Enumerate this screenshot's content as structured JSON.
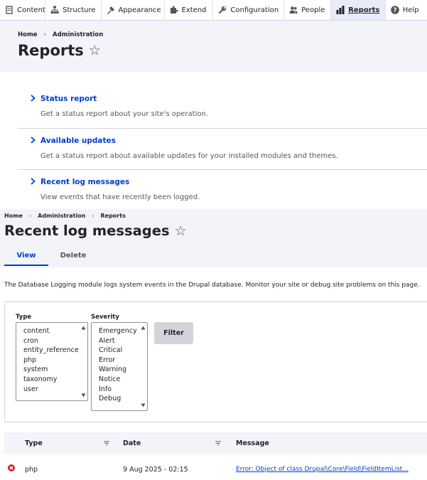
{
  "toolbar": {
    "items": [
      {
        "label": "Content",
        "icon": "content-icon"
      },
      {
        "label": "Structure",
        "icon": "structure-icon"
      },
      {
        "label": "Appearance",
        "icon": "appearance-icon"
      },
      {
        "label": "Extend",
        "icon": "extend-icon"
      },
      {
        "label": "Configuration",
        "icon": "configuration-icon"
      },
      {
        "label": "People",
        "icon": "people-icon"
      },
      {
        "label": "Reports",
        "icon": "reports-icon",
        "active": true
      },
      {
        "label": "Help",
        "icon": "help-icon"
      }
    ]
  },
  "reports_page": {
    "breadcrumb": [
      "Home",
      "Administration"
    ],
    "title": "Reports",
    "items": [
      {
        "title": "Status report",
        "description": "Get a status report about your site's operation."
      },
      {
        "title": "Available updates",
        "description": "Get a status report about available updates for your installed modules and themes."
      },
      {
        "title": "Recent log messages",
        "description": "View events that have recently been logged."
      }
    ]
  },
  "log_page": {
    "breadcrumb": [
      "Home",
      "Administration",
      "Reports"
    ],
    "title": "Recent log messages",
    "tabs": [
      {
        "label": "View",
        "active": true
      },
      {
        "label": "Delete",
        "active": false
      }
    ],
    "intro": "The Database Logging module logs system events in the Drupal database. Monitor your site or debug site problems on this page.",
    "filter": {
      "type_label": "Type",
      "type_options": [
        "content",
        "cron",
        "entity_reference",
        "php",
        "system",
        "taxonomy",
        "user"
      ],
      "severity_label": "Severity",
      "severity_options": [
        "Emergency",
        "Alert",
        "Critical",
        "Error",
        "Warning",
        "Notice",
        "Info",
        "Debug"
      ],
      "button": "Filter"
    },
    "table": {
      "headers": {
        "type": "Type",
        "date": "Date",
        "message": "Message"
      },
      "rows": [
        {
          "severity_icon": "error-icon",
          "type": "php",
          "date": "9 Aug 2025 - 02:15",
          "message": "Error: Object of class Drupal\\Core\\Field\\FieldItemList..."
        }
      ]
    }
  },
  "colors": {
    "link": "#003ecc",
    "error": "#d72222",
    "header_bg": "#f3f4f9"
  }
}
